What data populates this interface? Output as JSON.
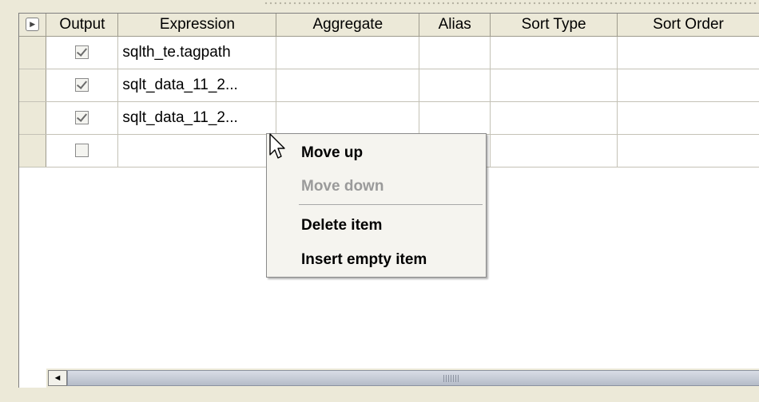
{
  "table": {
    "header_button_icon": "expand-arrow-icon",
    "columns": [
      "Output",
      "Expression",
      "Aggregate",
      "Alias",
      "Sort Type",
      "Sort Order"
    ],
    "rows": [
      {
        "output": true,
        "expression": "sqlth_te.tagpath",
        "aggregate": "",
        "alias": "",
        "sort_type": "",
        "sort_order": ""
      },
      {
        "output": true,
        "expression": "sqlt_data_11_2...",
        "aggregate": "",
        "alias": "",
        "sort_type": "",
        "sort_order": ""
      },
      {
        "output": true,
        "expression": "sqlt_data_11_2...",
        "aggregate": "",
        "alias": "",
        "sort_type": "",
        "sort_order": ""
      },
      {
        "output": false,
        "expression": "",
        "aggregate": "",
        "alias": "",
        "sort_type": "",
        "sort_order": ""
      }
    ]
  },
  "scrollbar": {
    "left_arrow": "◄"
  },
  "context_menu": {
    "items": [
      {
        "label": "Move up",
        "enabled": true
      },
      {
        "label": "Move down",
        "enabled": false
      },
      {
        "label": "Delete item",
        "enabled": true
      },
      {
        "label": "Insert empty item",
        "enabled": true
      }
    ]
  }
}
